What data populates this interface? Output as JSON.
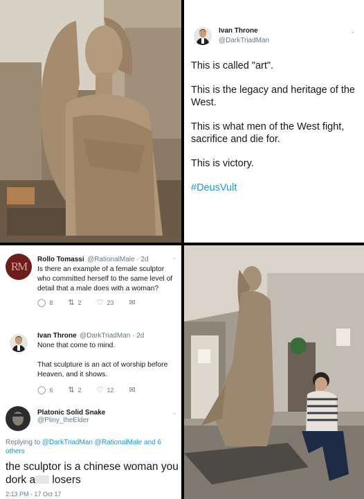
{
  "top_right_tweet": {
    "author_name": "Ivan Throne",
    "author_handle": "@DarkTriadMan",
    "lines": [
      "This is called \"art\".",
      "This is the legacy and heritage of the West.",
      "This is what men of the West fight, sacrifice and die for.",
      "This is victory."
    ],
    "hashtag": "#DeusVult",
    "menu_icon": "chevron-down-icon"
  },
  "thread": {
    "tweet1": {
      "avatar_text": "RM",
      "name": "Rollo Tomassi",
      "handle_time": "@RationalMale · 2d",
      "text": "Is there an example of a female sculptor who committed herself to the same level of detail that a male does with a woman?",
      "replies": "8",
      "retweets": "2",
      "likes": "23"
    },
    "tweet2": {
      "name": "Ivan Throne",
      "handle_time": "@DarkTriadMan · 2d",
      "text1": "None that come to mind.",
      "text2": "That sculpture is an act of worship before Heaven, and it shows.",
      "replies": "6",
      "retweets": "2",
      "likes": "12"
    },
    "reply": {
      "name": "Platonic Solid Snake",
      "handle": "@Pliny_theElder",
      "replying_prefix": "Replying to ",
      "replying_links": "@DarkTriadMan @RationalMale and 6 others",
      "text_before": "the sculptor is a chinese woman you dork a",
      "text_after": " losers",
      "timestamp": "2:13 PM - 17 Oct 17"
    }
  },
  "icons": {
    "reply": "reply-icon",
    "retweet": "retweet-icon",
    "like": "heart-icon",
    "message": "envelope-icon"
  },
  "colors": {
    "link": "#1b95e0",
    "text": "#14171a",
    "muted": "#657786"
  }
}
